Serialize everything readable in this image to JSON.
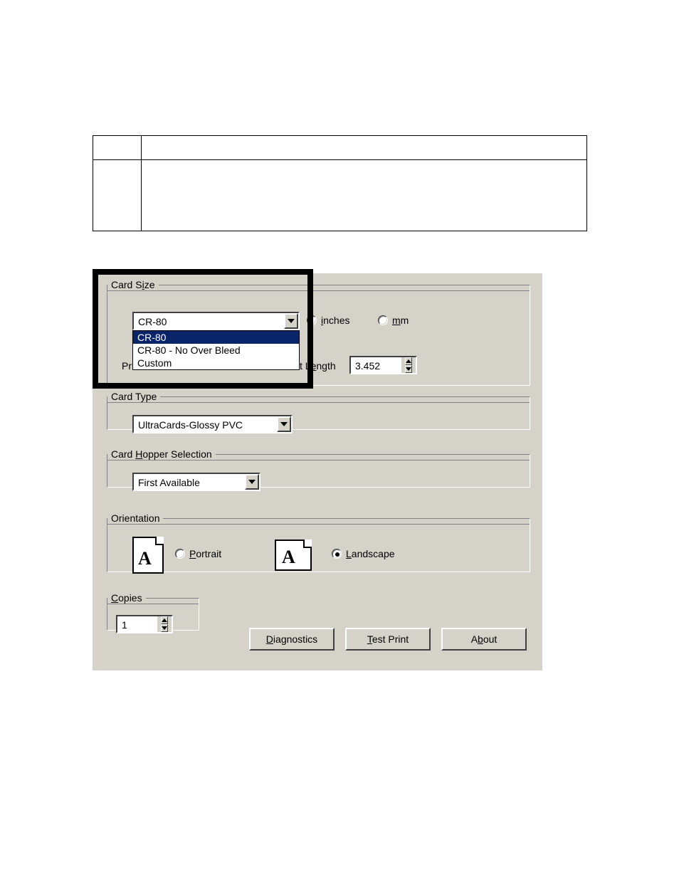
{
  "card_size": {
    "legend_pre": "Card S",
    "legend_u": "i",
    "legend_post": "ze",
    "selected": "CR-80",
    "options": [
      "CR-80",
      "CR-80 - No Over Bleed",
      "Custom"
    ],
    "unit_inches_u": "i",
    "unit_inches_post": "nches",
    "unit_mm_u": "m",
    "unit_mm_post": "m",
    "print_width_prefix": "Pri",
    "length_pre": "t L",
    "length_u": "e",
    "length_post": "ngth",
    "length_value": "3.452"
  },
  "card_type": {
    "legend": "Card Type",
    "selected": "UltraCards-Glossy PVC"
  },
  "hopper": {
    "legend_pre": "Card ",
    "legend_u": "H",
    "legend_post": "opper Selection",
    "selected": "First Available"
  },
  "orientation": {
    "legend": "Orientation",
    "portrait_u": "P",
    "portrait_post": "ortrait",
    "landscape_u": "L",
    "landscape_post": "andscape",
    "selected": "landscape",
    "letter": "A"
  },
  "copies": {
    "legend_u": "C",
    "legend_post": "opies",
    "value": "1"
  },
  "buttons": {
    "diagnostics_u": "D",
    "diagnostics_post": "iagnostics",
    "testprint_u": "T",
    "testprint_post": "est Print",
    "about_pre": "A",
    "about_u": "b",
    "about_post": "out"
  }
}
